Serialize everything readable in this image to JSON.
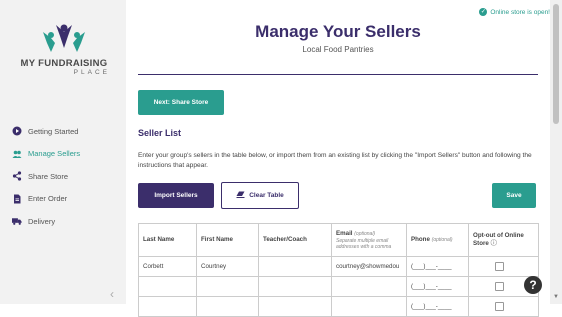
{
  "brand": {
    "line1": "MY FUNDRAISING",
    "line2": "PLACE"
  },
  "status": {
    "text": "Online store is open!",
    "icon": "check-circle-icon"
  },
  "nav": [
    {
      "label": "Getting Started",
      "icon": "play-circle-icon",
      "active": false
    },
    {
      "label": "Manage Sellers",
      "icon": "users-icon",
      "active": true
    },
    {
      "label": "Share Store",
      "icon": "share-icon",
      "active": false
    },
    {
      "label": "Enter Order",
      "icon": "document-icon",
      "active": false
    },
    {
      "label": "Delivery",
      "icon": "truck-icon",
      "active": false
    }
  ],
  "page": {
    "title": "Manage Your Sellers",
    "subtitle": "Local Food Pantries",
    "next_button": "Next: Share Store",
    "section_title": "Seller List",
    "description": "Enter your group's sellers in the table below, or import them from an existing list by clicking the \"Import Sellers\" button and following the instructions that appear."
  },
  "buttons": {
    "import": "Import Sellers",
    "clear": "Clear Table",
    "save": "Save"
  },
  "table": {
    "headers": {
      "last_name": "Last Name",
      "first_name": "First Name",
      "teacher": "Teacher/Coach",
      "email": "Email",
      "email_optional": "(optional)",
      "email_note": "Separate multiple email addresses with a comma",
      "phone": "Phone",
      "phone_optional": "(optional)",
      "optout": "Opt-out of Online Store"
    },
    "rows": [
      {
        "last": "Corbett",
        "first": "Courtney",
        "teacher": "",
        "email": "courtney@showmedou",
        "phone": "(___)___-____"
      },
      {
        "last": "",
        "first": "",
        "teacher": "",
        "email": "",
        "phone": "(___)___-____"
      },
      {
        "last": "",
        "first": "",
        "teacher": "",
        "email": "",
        "phone": "(___)___-____"
      }
    ]
  },
  "colors": {
    "accent": "#2a9d8f",
    "brand": "#3b2e6b"
  }
}
